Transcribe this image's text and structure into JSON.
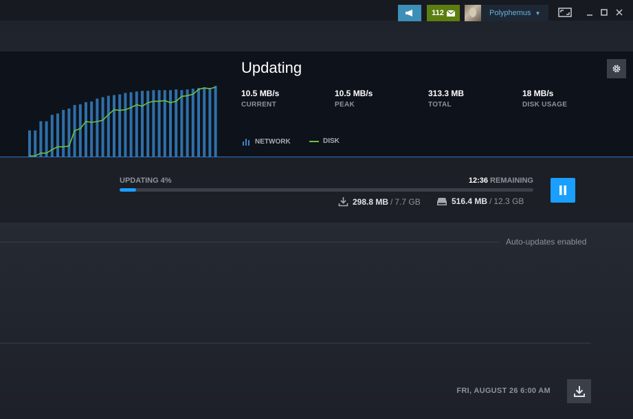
{
  "titlebar": {
    "notifications_count": "112",
    "username": "Polyphemus",
    "icons": [
      "broadcast-icon",
      "envelope-icon",
      "chevron-down-icon",
      "big-picture-icon",
      "minimize-icon",
      "maximize-icon",
      "close-icon"
    ]
  },
  "download": {
    "title": "Updating",
    "stats": [
      {
        "value": "10.5 MB/s",
        "label": "CURRENT"
      },
      {
        "value": "10.5 MB/s",
        "label": "PEAK"
      },
      {
        "value": "313.3 MB",
        "label": "TOTAL"
      },
      {
        "value": "18 MB/s",
        "label": "DISK USAGE"
      }
    ],
    "legend": {
      "network": "NETWORK",
      "disk": "DISK"
    },
    "colors": {
      "network": "#2f6fa8",
      "disk": "#6fc23f",
      "accent": "#1a9fff"
    },
    "chart_data": {
      "type": "bar",
      "series": [
        {
          "name": "NETWORK",
          "values": [
            0.37,
            0.37,
            0.5,
            0.5,
            0.59,
            0.61,
            0.66,
            0.68,
            0.73,
            0.74,
            0.77,
            0.78,
            0.82,
            0.84,
            0.86,
            0.87,
            0.88,
            0.9,
            0.91,
            0.92,
            0.93,
            0.93,
            0.94,
            0.94,
            0.94,
            0.94,
            0.95,
            0.94,
            0.95,
            0.96,
            0.97,
            0.98,
            0.97,
            1.0
          ]
        },
        {
          "name": "DISK",
          "values": [
            0.0,
            0.0,
            0.04,
            0.04,
            0.09,
            0.13,
            0.13,
            0.14,
            0.36,
            0.39,
            0.49,
            0.48,
            0.49,
            0.51,
            0.59,
            0.66,
            0.65,
            0.66,
            0.69,
            0.73,
            0.71,
            0.76,
            0.78,
            0.78,
            0.79,
            0.76,
            0.78,
            0.85,
            0.86,
            0.88,
            0.95,
            0.97,
            0.96,
            0.98
          ]
        }
      ]
    }
  },
  "progress": {
    "status": "UPDATING 4%",
    "percent": 4,
    "remaining_time": "12:36",
    "remaining_label": "REMAINING",
    "downloaded": "298.8 MB",
    "download_total": "7.7 GB",
    "disk_written": "516.4 MB",
    "disk_total": "12.3 GB"
  },
  "queue": {
    "auto_updates": "Auto-updates enabled",
    "scheduled": "FRI, AUGUST 26 6:00 AM"
  }
}
